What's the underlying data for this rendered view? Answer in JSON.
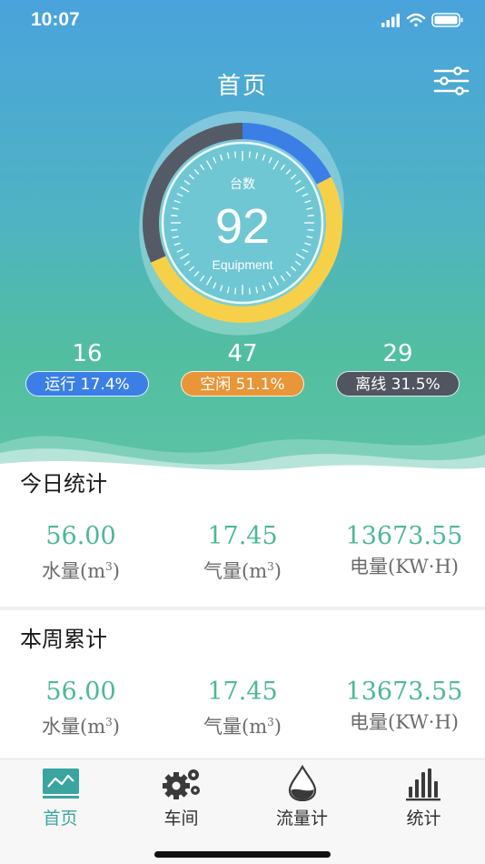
{
  "status_bar": {
    "time": "10:07"
  },
  "nav": {
    "title": "首页"
  },
  "gauge": {
    "caption_top": "台数",
    "total": "92",
    "caption_bottom": "Equipment",
    "segments": [
      {
        "name": "running",
        "fraction": 0.174,
        "color": "#3b7fe6"
      },
      {
        "name": "idle",
        "fraction": 0.511,
        "color": "#f7d04a"
      },
      {
        "name": "offline",
        "fraction": 0.315,
        "color": "#555b66"
      }
    ]
  },
  "stats": {
    "running": {
      "count": "16",
      "label": "运行 17.4%"
    },
    "idle": {
      "count": "47",
      "label": "空闲 51.1%"
    },
    "offline": {
      "count": "29",
      "label": "离线 31.5%"
    }
  },
  "today": {
    "title": "今日统计",
    "water": {
      "value": "56.00",
      "label": "水量(m",
      "unit_sup": "3",
      "label_end": ")"
    },
    "gas": {
      "value": "17.45",
      "label": "气量(m",
      "unit_sup": "3",
      "label_end": ")"
    },
    "power": {
      "value": "13673.55",
      "label": "电量(KW·H)"
    }
  },
  "week": {
    "title": "本周累计",
    "water": {
      "value": "56.00",
      "label": "水量(m",
      "unit_sup": "3",
      "label_end": ")"
    },
    "gas": {
      "value": "17.45",
      "label": "气量(m",
      "unit_sup": "3",
      "label_end": ")"
    },
    "power": {
      "value": "13673.55",
      "label": "电量(KW·H)"
    }
  },
  "tabs": [
    {
      "label": "首页",
      "icon": "monitor-chart-icon",
      "active": true
    },
    {
      "label": "车间",
      "icon": "gears-icon",
      "active": false
    },
    {
      "label": "流量计",
      "icon": "water-drop-icon",
      "active": false
    },
    {
      "label": "统计",
      "icon": "bar-chart-icon",
      "active": false
    }
  ],
  "colors": {
    "accent": "#4db896",
    "tab_active": "#3aa5a0"
  }
}
